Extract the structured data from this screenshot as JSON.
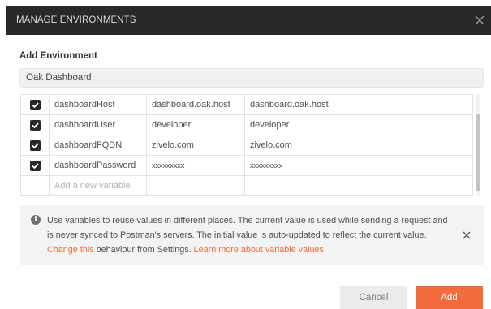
{
  "dialog": {
    "title": "MANAGE ENVIRONMENTS",
    "close_icon": "close-icon"
  },
  "form": {
    "section_label": "Add Environment",
    "environment_name": "Oak Dashboard"
  },
  "variables": [
    {
      "enabled": true,
      "key": "dashboardHost",
      "initial_value": "dashboard.oak.host",
      "current_value": "dashboard.oak.host"
    },
    {
      "enabled": true,
      "key": "dashboardUser",
      "initial_value": "developer",
      "current_value": "developer"
    },
    {
      "enabled": true,
      "key": "dashboardFQDN",
      "initial_value": "zivelo.com",
      "current_value": "zivelo.com"
    },
    {
      "enabled": true,
      "key": "dashboardPassword",
      "initial_value": "xxxxxxxxx",
      "current_value": "xxxxxxxxx"
    }
  ],
  "new_variable_placeholder": "Add a new variable",
  "info": {
    "icon": "info-icon",
    "text_before": "Use variables to reuse values in different places. The current value is used while sending a request and is never synced to Postman's servers. The initial value is auto-updated to reflect the current value. ",
    "link_change": "Change this",
    "text_middle": " behaviour from Settings. ",
    "link_learn_more": "Learn more about variable values"
  },
  "buttons": {
    "cancel_label": "Cancel",
    "add_label": "Add"
  },
  "colors": {
    "accent": "#f26b3a",
    "titlebar": "#282828"
  }
}
